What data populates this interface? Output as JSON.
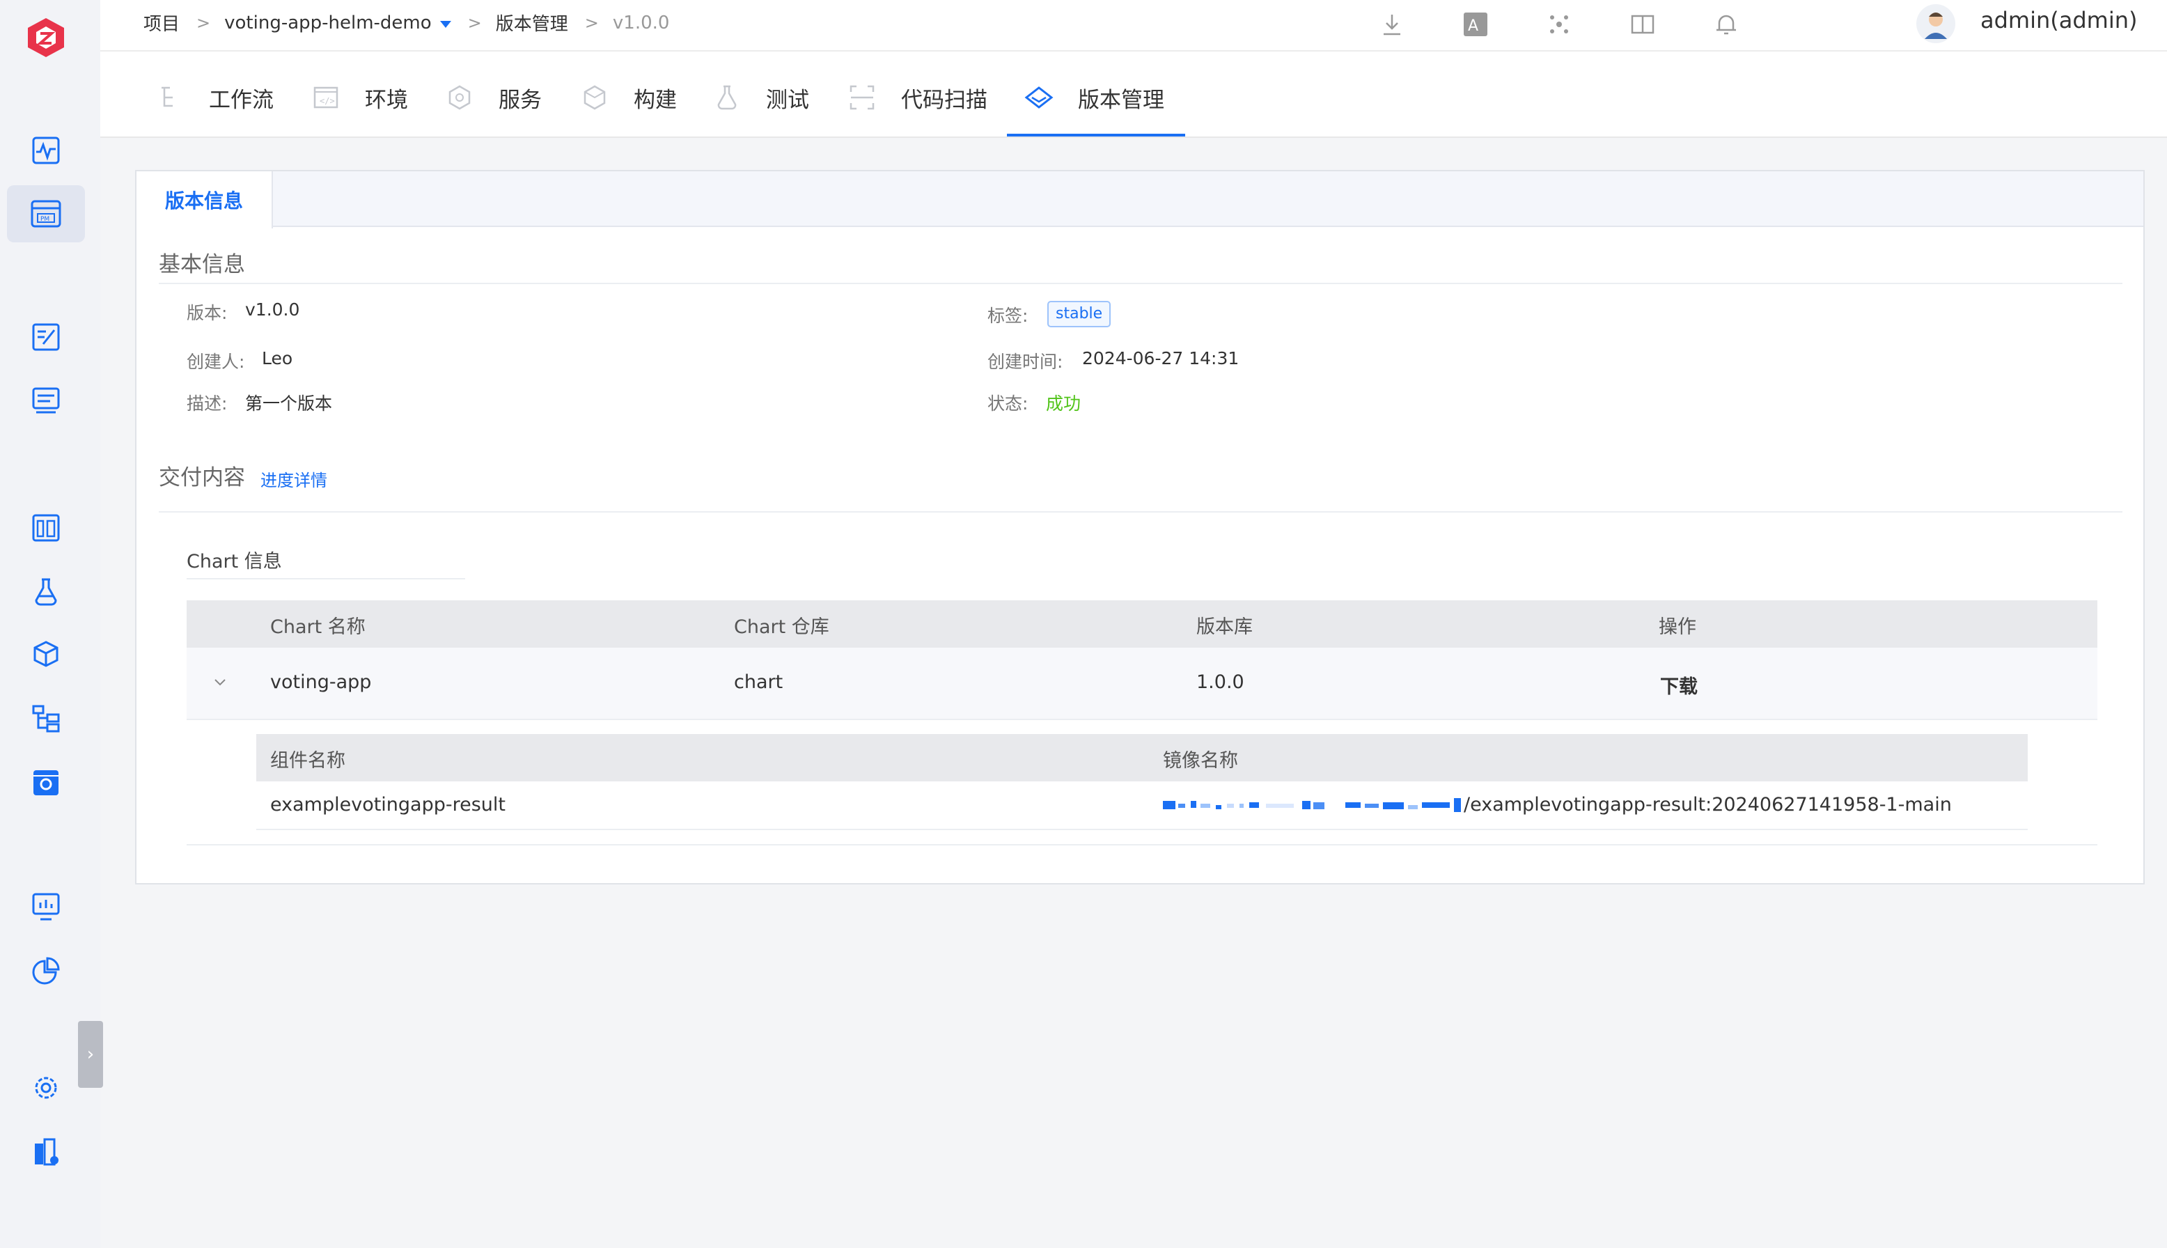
{
  "sidebar": {
    "icons": [
      "logo-icon",
      "pulse-icon",
      "pm-icon",
      "edit-doc-icon",
      "delivery-icon",
      "dashboard-icon",
      "flask-icon",
      "package-icon",
      "tree-icon",
      "settings-box-icon",
      "monitor-chart-icon",
      "pie-chart-icon",
      "gear-icon",
      "building-icon"
    ],
    "collapse_glyph": "›"
  },
  "breadcrumb": {
    "project": "项目",
    "project_name": "voting-app-helm-demo",
    "section": "版本管理",
    "version": "v1.0.0",
    "sep": ">"
  },
  "topbar": {
    "icons": [
      "download-icon",
      "translate-icon",
      "network-icon",
      "book-icon",
      "bell-icon"
    ],
    "user_name": "admin(admin)",
    "more": "⋮"
  },
  "nav_tabs": [
    {
      "label": "工作流",
      "icon": "workflow-icon"
    },
    {
      "label": "环境",
      "icon": "environment-icon"
    },
    {
      "label": "服务",
      "icon": "service-icon"
    },
    {
      "label": "构建",
      "icon": "build-icon"
    },
    {
      "label": "测试",
      "icon": "test-icon"
    },
    {
      "label": "代码扫描",
      "icon": "scan-icon"
    },
    {
      "label": "版本管理",
      "icon": "version-icon",
      "active": true
    }
  ],
  "card": {
    "tab_label": "版本信息",
    "basic_title": "基本信息",
    "fields": {
      "version_label": "版本:",
      "version_value": "v1.0.0",
      "tag_label": "标签:",
      "tag_value": "stable",
      "creator_label": "创建人:",
      "creator_value": "Leo",
      "created_label": "创建时间:",
      "created_value": "2024-06-27 14:31",
      "desc_label": "描述:",
      "desc_value": "第一个版本",
      "status_label": "状态:",
      "status_value": "成功"
    },
    "delivery_title": "交付内容",
    "progress_link": "进度详情",
    "chart_info_title": "Chart 信息",
    "table": {
      "headers": [
        "Chart 名称",
        "Chart 仓库",
        "版本库",
        "操作"
      ],
      "rows": [
        {
          "name": "voting-app",
          "repo": "chart",
          "version": "1.0.0",
          "action": "下载"
        }
      ],
      "sub_headers": [
        "组件名称",
        "镜像名称"
      ],
      "sub_rows": [
        {
          "component": "examplevotingapp-result",
          "image": "/examplevotingapp-result:20240627141958-1-main"
        }
      ]
    }
  },
  "colors": {
    "accent": "#1a6ff3",
    "success": "#52c41a",
    "brand": "#e8334a"
  }
}
